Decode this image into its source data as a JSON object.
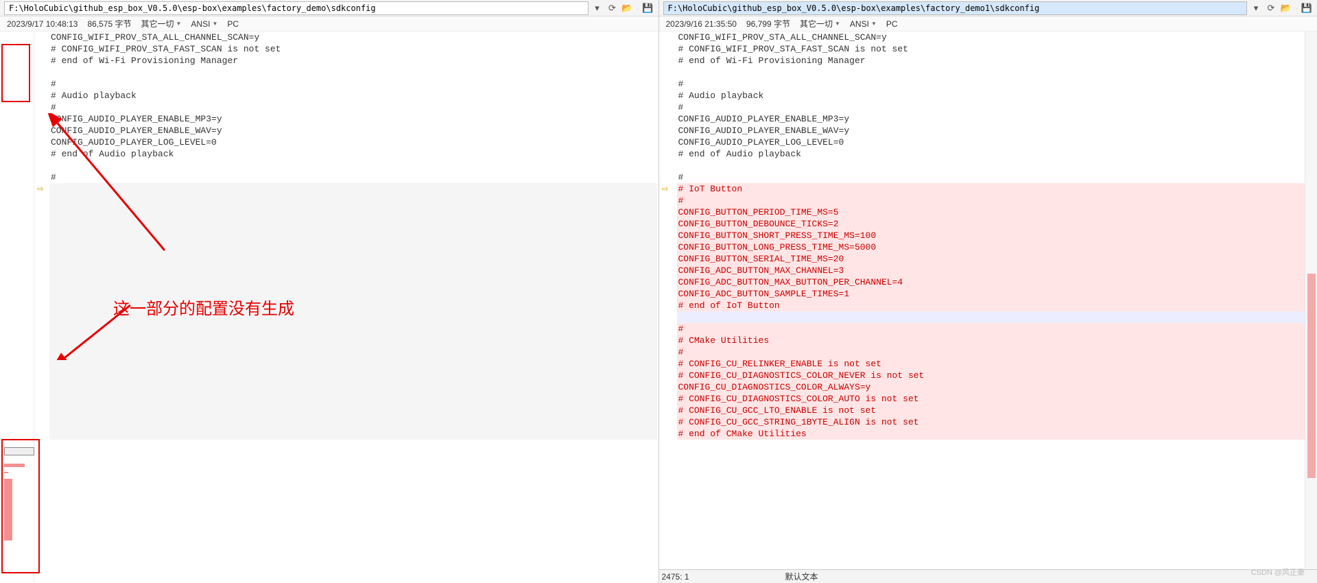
{
  "left": {
    "path": "F:\\HoloCubic\\github_esp_box_V0.5.0\\esp-box\\examples\\factory_demo\\sdkconfig",
    "date": "2023/9/17 10:48:13",
    "size": "86,575 字节",
    "misc": "其它一切",
    "encoding": "ANSI",
    "eol": "PC",
    "code_common": [
      "CONFIG_WIFI_PROV_STA_ALL_CHANNEL_SCAN=y",
      "# CONFIG_WIFI_PROV_STA_FAST_SCAN is not set",
      "# end of Wi-Fi Provisioning Manager",
      "",
      "#",
      "# Audio playback",
      "#",
      "CONFIG_AUDIO_PLAYER_ENABLE_MP3=y",
      "CONFIG_AUDIO_PLAYER_ENABLE_WAV=y",
      "CONFIG_AUDIO_PLAYER_LOG_LEVEL=0",
      "# end of Audio playback",
      "",
      "#"
    ]
  },
  "right": {
    "path": "F:\\HoloCubic\\github_esp_box_V0.5.0\\esp-box\\examples\\factory_demo1\\sdkconfig",
    "date": "2023/9/16 21:35:50",
    "size": "96,799 字节",
    "misc": "其它一切",
    "encoding": "ANSI",
    "eol": "PC",
    "code_common": [
      "CONFIG_WIFI_PROV_STA_ALL_CHANNEL_SCAN=y",
      "# CONFIG_WIFI_PROV_STA_FAST_SCAN is not set",
      "# end of Wi-Fi Provisioning Manager",
      "",
      "#",
      "# Audio playback",
      "#",
      "CONFIG_AUDIO_PLAYER_ENABLE_MP3=y",
      "CONFIG_AUDIO_PLAYER_ENABLE_WAV=y",
      "CONFIG_AUDIO_PLAYER_LOG_LEVEL=0",
      "# end of Audio playback",
      "",
      "#"
    ],
    "code_diff": [
      "# IoT Button",
      "#",
      "CONFIG_BUTTON_PERIOD_TIME_MS=5",
      "CONFIG_BUTTON_DEBOUNCE_TICKS=2",
      "CONFIG_BUTTON_SHORT_PRESS_TIME_MS=100",
      "CONFIG_BUTTON_LONG_PRESS_TIME_MS=5000",
      "CONFIG_BUTTON_SERIAL_TIME_MS=20",
      "CONFIG_ADC_BUTTON_MAX_CHANNEL=3",
      "CONFIG_ADC_BUTTON_MAX_BUTTON_PER_CHANNEL=4",
      "CONFIG_ADC_BUTTON_SAMPLE_TIMES=1",
      "# end of IoT Button",
      "",
      "#",
      "# CMake Utilities",
      "#",
      "# CONFIG_CU_RELINKER_ENABLE is not set",
      "# CONFIG_CU_DIAGNOSTICS_COLOR_NEVER is not set",
      "CONFIG_CU_DIAGNOSTICS_COLOR_ALWAYS=y",
      "# CONFIG_CU_DIAGNOSTICS_COLOR_AUTO is not set",
      "# CONFIG_CU_GCC_LTO_ENABLE is not set",
      "# CONFIG_CU_GCC_STRING_1BYTE_ALIGN is not set",
      "# end of CMake Utilities"
    ],
    "status_pos": "2475: 1",
    "status_type": "默认文本"
  },
  "annotation_text": "这一部分的配置没有生成",
  "watermark": "CSDN @风正豪"
}
